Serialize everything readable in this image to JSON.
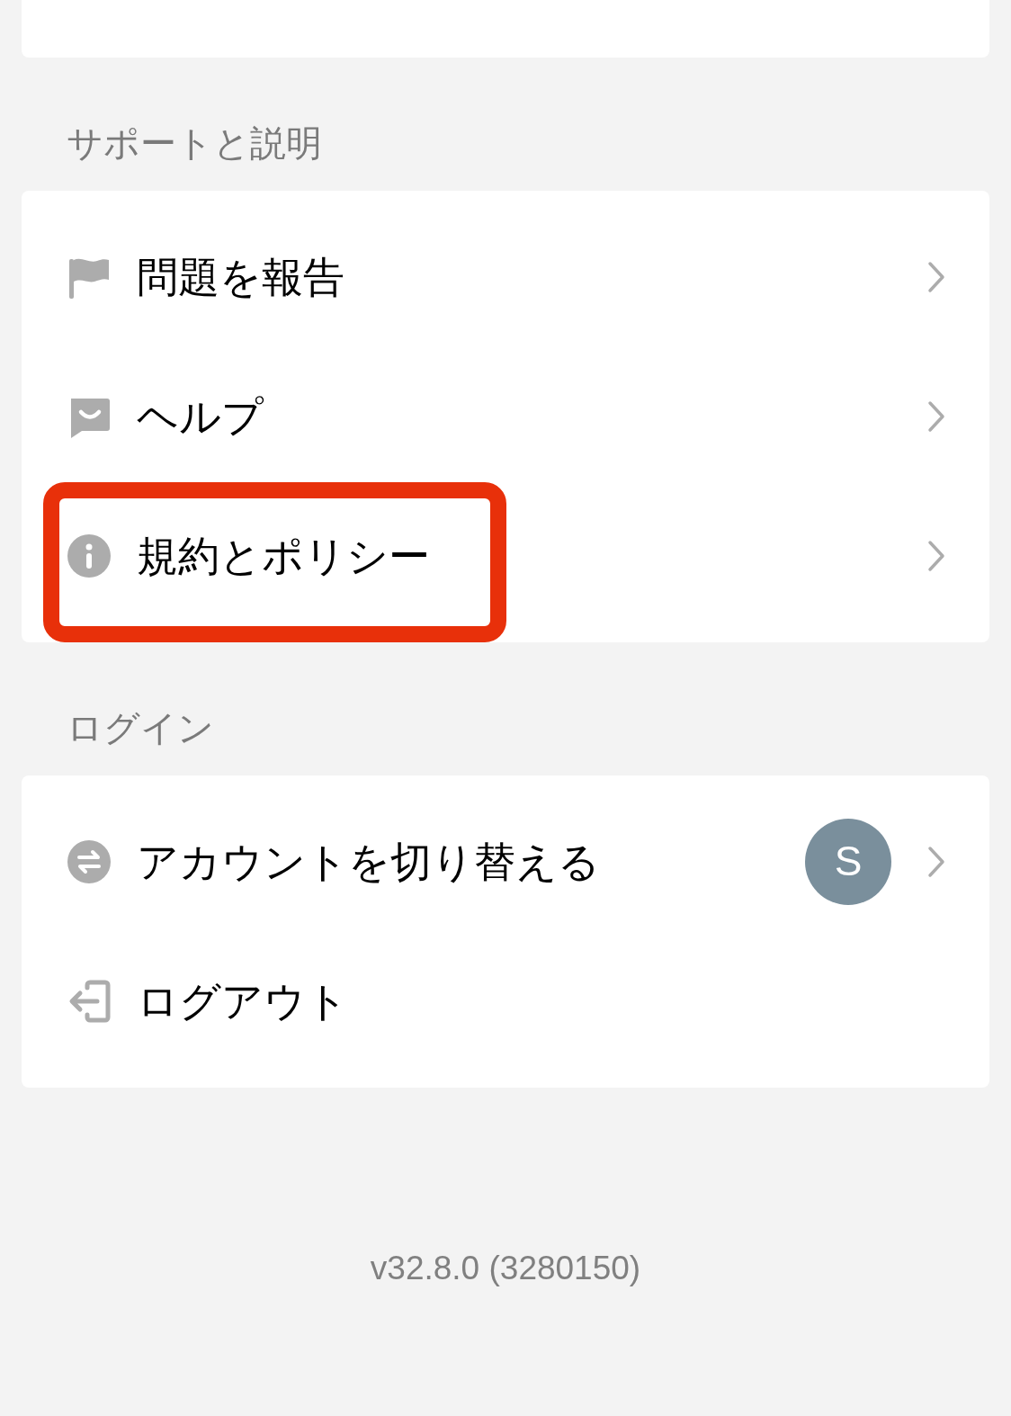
{
  "sections": [
    {
      "title": "サポートと説明",
      "items": [
        {
          "kind": "flag",
          "label": "問題を報告",
          "chevron": true,
          "highlighted": false
        },
        {
          "kind": "chat",
          "label": "ヘルプ",
          "chevron": true,
          "highlighted": false
        },
        {
          "kind": "info",
          "label": "規約とポリシー",
          "chevron": true,
          "highlighted": true
        }
      ]
    },
    {
      "title": "ログイン",
      "items": [
        {
          "kind": "swap",
          "label": "アカウントを切り替える",
          "avatar": "S",
          "chevron": true,
          "highlighted": false
        },
        {
          "kind": "exit",
          "label": "ログアウト",
          "chevron": false,
          "highlighted": false
        }
      ]
    }
  ],
  "version": "v32.8.0 (3280150)"
}
